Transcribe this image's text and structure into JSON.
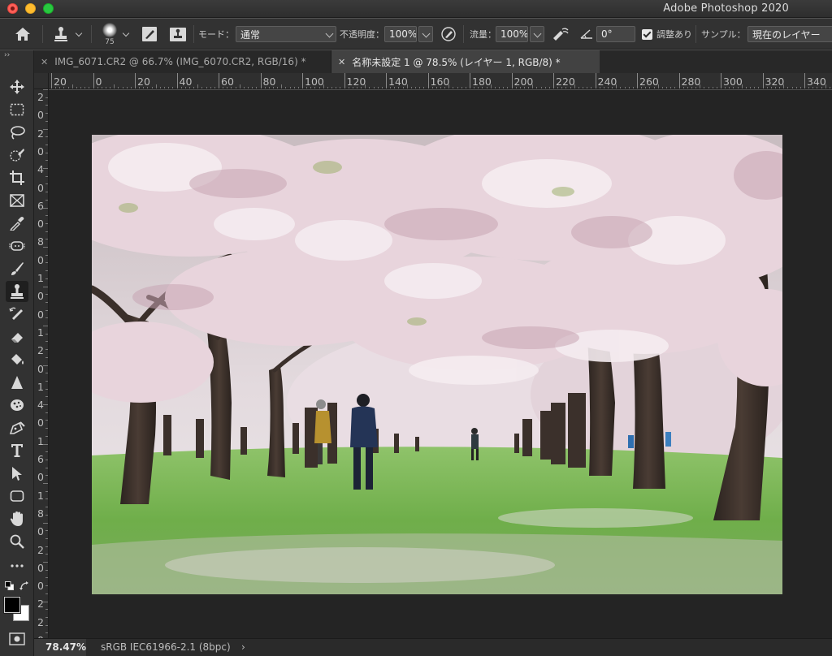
{
  "window": {
    "title": "Adobe Photoshop 2020"
  },
  "options_bar": {
    "brush_size": "75",
    "mode_label": "モード：",
    "mode_value": "通常",
    "opacity_label": "不透明度：",
    "opacity_value": "100%",
    "flow_label": "流量：",
    "flow_value": "100%",
    "angle_value": "0°",
    "aligned_label": "調整あり",
    "sample_label": "サンプル：",
    "sample_value": "現在のレイヤー"
  },
  "panel_collapse": "››",
  "tabs": [
    {
      "label": "IMG_6071.CR2 @ 66.7% (IMG_6070.CR2, RGB/16) *",
      "close": "✕",
      "active": false
    },
    {
      "label": "名称未設定 1 @ 78.5% (レイヤー 1, RGB/8) *",
      "close": "✕",
      "active": true
    }
  ],
  "ruler_top": [
    "20",
    "0",
    "20",
    "40",
    "60",
    "80",
    "100",
    "120",
    "140",
    "160",
    "180",
    "200",
    "220",
    "240",
    "260",
    "280",
    "300",
    "320",
    "340"
  ],
  "ruler_left": [
    "2",
    "0",
    "2",
    "0",
    "4",
    "0",
    "6",
    "0",
    "8",
    "0",
    "1",
    "0",
    "0",
    "1",
    "2",
    "0",
    "1",
    "4",
    "0",
    "1",
    "6",
    "0",
    "1",
    "8",
    "0",
    "2",
    "0",
    "0",
    "2",
    "2",
    "0",
    "2"
  ],
  "tools": [
    "move-tool-icon",
    "marquee-tool-icon",
    "lasso-tool-icon",
    "quick-select-tool-icon",
    "crop-tool-icon",
    "frame-tool-icon",
    "eyedropper-tool-icon",
    "healing-brush-tool-icon",
    "brush-tool-icon",
    "clone-stamp-tool-icon",
    "history-brush-tool-icon",
    "eraser-tool-icon",
    "paint-bucket-tool-icon",
    "sharpen-tool-icon",
    "sponge-tool-icon",
    "pen-tool-icon",
    "type-tool-icon",
    "path-selection-tool-icon",
    "rectangle-tool-icon",
    "hand-tool-icon",
    "zoom-tool-icon",
    "edit-toolbar-icon"
  ],
  "colors": {
    "foreground": "#000000",
    "background": "#ffffff",
    "ui_dark": "#323232",
    "canvas_bg": "#242424"
  },
  "status_bar": {
    "zoom": "78.47%",
    "info": "sRGB IEC61966-2.1 (8bpc)",
    "arrow": "›"
  }
}
